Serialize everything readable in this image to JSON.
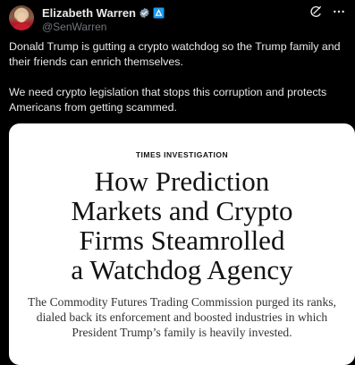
{
  "author": {
    "display_name": "Elizabeth Warren",
    "handle": "@SenWarren",
    "badges": [
      "verified-gray-icon",
      "government-flag-icon"
    ]
  },
  "actions": {
    "grok_icon": "grok-icon",
    "more_icon": "more-icon"
  },
  "tweet": {
    "paragraph_1": "Donald Trump is gutting a crypto watchdog so the Trump family and their friends can enrich themselves.",
    "paragraph_2": "We need crypto legislation that stops this corruption and protects Americans from getting scammed."
  },
  "card": {
    "kicker": "TIMES INVESTIGATION",
    "headline_lines": [
      "How Prediction",
      "Markets and Crypto",
      "Firms Steamrolled",
      "a Watchdog Agency"
    ],
    "summary_lines": [
      "The Commodity Futures Trading Commission purged its ranks,",
      "dialed back its enforcement and boosted industries in which",
      "President Trump’s family is heavily invested."
    ]
  },
  "colors": {
    "background": "#000000",
    "text_primary": "#e7e9ea",
    "text_secondary": "#71767b",
    "verified_badge": "#829aab",
    "gov_badge": "#1d9bf0",
    "card_background": "#ffffff"
  }
}
